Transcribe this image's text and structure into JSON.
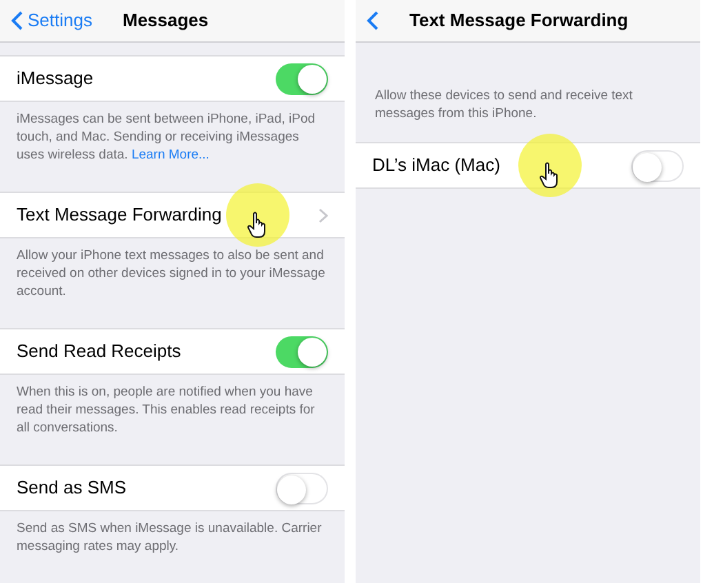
{
  "screens": [
    {
      "nav": {
        "back": "Settings",
        "title": "Messages"
      },
      "groups": [
        {
          "rows": [
            {
              "kind": "toggle",
              "label": "iMessage",
              "on": true,
              "cursor": false
            }
          ],
          "footer": "iMessages can be sent between iPhone, iPad, iPod touch, and Mac. Sending or receiving iMessages uses wireless data.",
          "link": "Learn More..."
        },
        {
          "rows": [
            {
              "kind": "disclosure",
              "label": "Text Message Forwarding",
              "cursor": true
            }
          ],
          "footer": "Allow your iPhone text messages to also be sent and received on other devices signed in to your iMessage account."
        },
        {
          "rows": [
            {
              "kind": "toggle",
              "label": "Send Read Receipts",
              "on": true,
              "cursor": false
            }
          ],
          "footer": "When this is on, people are notified when you have read their messages. This enables read receipts for all conversations."
        },
        {
          "rows": [
            {
              "kind": "toggle",
              "label": "Send as SMS",
              "on": false,
              "cursor": false
            }
          ],
          "footer": "Send as SMS when iMessage is unavailable. Carrier messaging rates may apply."
        }
      ]
    },
    {
      "nav": {
        "title": "Text Message Forwarding"
      },
      "intro": "Allow these devices to send and receive text messages from this iPhone.",
      "groups": [
        {
          "rows": [
            {
              "kind": "toggle",
              "label": "DL’s iMac (Mac)",
              "on": false,
              "cursor": true
            }
          ]
        }
      ]
    }
  ]
}
